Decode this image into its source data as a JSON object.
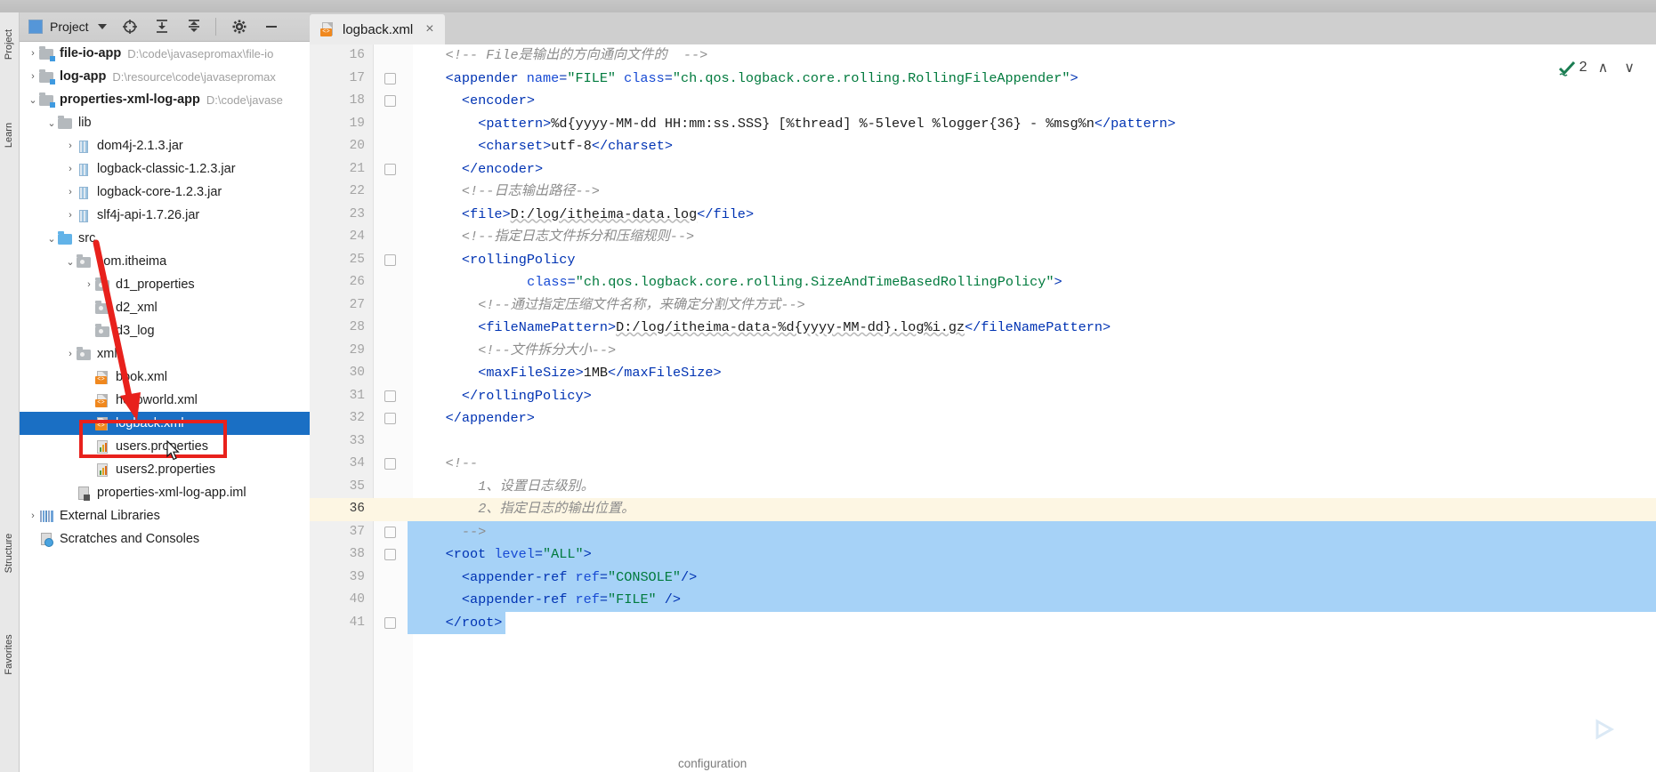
{
  "window": {
    "vertical_tabs": [
      "Project",
      "Learn",
      "Structure",
      "Favorites"
    ]
  },
  "project_panel": {
    "title": "Project",
    "toolbar_icons": [
      "target-icon",
      "expand-all-icon",
      "collapse-all-icon",
      "gear-icon",
      "minimize-icon"
    ],
    "tree": [
      {
        "id": "file-io-app",
        "label": "file-io-app",
        "path": "D:\\code\\javasepromax\\file-io",
        "indent": 0,
        "arrow": "right",
        "icon": "module-folder-icon",
        "bold": true
      },
      {
        "id": "log-app",
        "label": "log-app",
        "path": "D:\\resource\\code\\javasepromax",
        "indent": 0,
        "arrow": "right",
        "icon": "module-folder-icon",
        "bold": true
      },
      {
        "id": "properties-xml-log-app",
        "label": "properties-xml-log-app",
        "path": "D:\\code\\javase",
        "indent": 0,
        "arrow": "down",
        "icon": "module-folder-icon",
        "bold": true
      },
      {
        "id": "lib",
        "label": "lib",
        "path": "",
        "indent": 1,
        "arrow": "down",
        "icon": "folder-icon",
        "bold": false
      },
      {
        "id": "dom4j",
        "label": "dom4j-2.1.3.jar",
        "path": "",
        "indent": 2,
        "arrow": "right",
        "icon": "jar-icon",
        "bold": false
      },
      {
        "id": "logback-classic",
        "label": "logback-classic-1.2.3.jar",
        "path": "",
        "indent": 2,
        "arrow": "right",
        "icon": "jar-icon",
        "bold": false
      },
      {
        "id": "logback-core",
        "label": "logback-core-1.2.3.jar",
        "path": "",
        "indent": 2,
        "arrow": "right",
        "icon": "jar-icon",
        "bold": false
      },
      {
        "id": "slf4j-api",
        "label": "slf4j-api-1.7.26.jar",
        "path": "",
        "indent": 2,
        "arrow": "right",
        "icon": "jar-icon",
        "bold": false
      },
      {
        "id": "src",
        "label": "src",
        "path": "",
        "indent": 1,
        "arrow": "down",
        "icon": "source-folder-icon",
        "bold": false
      },
      {
        "id": "com.itheima",
        "label": "com.itheima",
        "path": "",
        "indent": 2,
        "arrow": "down",
        "icon": "package-icon",
        "bold": false
      },
      {
        "id": "d1_properties",
        "label": "d1_properties",
        "path": "",
        "indent": 3,
        "arrow": "right",
        "icon": "package-icon",
        "bold": false
      },
      {
        "id": "d2_xml",
        "label": "d2_xml",
        "path": "",
        "indent": 3,
        "arrow": "none",
        "icon": "package-icon",
        "bold": false
      },
      {
        "id": "d3_log",
        "label": "d3_log",
        "path": "",
        "indent": 3,
        "arrow": "none",
        "icon": "package-icon",
        "bold": false
      },
      {
        "id": "xml",
        "label": "xml",
        "path": "",
        "indent": 2,
        "arrow": "right",
        "icon": "package-icon",
        "bold": false
      },
      {
        "id": "book.xml",
        "label": "book.xml",
        "path": "",
        "indent": 3,
        "arrow": "none",
        "icon": "xml-file-icon",
        "bold": false
      },
      {
        "id": "helloworld.xml",
        "label": "helloworld.xml",
        "path": "",
        "indent": 3,
        "arrow": "none",
        "icon": "xml-file-icon",
        "bold": false
      },
      {
        "id": "logback.xml",
        "label": "logback.xml",
        "path": "",
        "indent": 3,
        "arrow": "none",
        "icon": "xml-file-icon",
        "bold": false,
        "selected": true
      },
      {
        "id": "users.properties",
        "label": "users.properties",
        "path": "",
        "indent": 3,
        "arrow": "none",
        "icon": "properties-file-icon",
        "bold": false
      },
      {
        "id": "users2.properties",
        "label": "users2.properties",
        "path": "",
        "indent": 3,
        "arrow": "none",
        "icon": "properties-file-icon",
        "bold": false
      },
      {
        "id": "properties-xml-log-app.iml",
        "label": "properties-xml-log-app.iml",
        "path": "",
        "indent": 2,
        "arrow": "none",
        "icon": "iml-file-icon",
        "bold": false
      },
      {
        "id": "External Libraries",
        "label": "External Libraries",
        "path": "",
        "indent": 0,
        "arrow": "right",
        "icon": "external-libraries-icon",
        "bold": false
      },
      {
        "id": "Scratches and Consoles",
        "label": "Scratches and Consoles",
        "path": "",
        "indent": 0,
        "arrow": "none",
        "icon": "scratches-icon",
        "bold": false
      }
    ]
  },
  "editor": {
    "tab": {
      "label": "logback.xml",
      "close": "×",
      "icon": "xml-file-icon"
    },
    "breadcrumb": "configuration",
    "inspection": {
      "count": "2",
      "up": "∧",
      "down": "∨",
      "icon": "inspection-ok-icon"
    },
    "first_line_number": 16,
    "lines": [
      {
        "n": 16,
        "indent": 2,
        "fold": "none",
        "segs": [
          {
            "t": "cmt",
            "s": "<!-- File是输出的方向通向文件的  -->"
          }
        ]
      },
      {
        "n": 17,
        "indent": 2,
        "fold": "open",
        "segs": [
          {
            "t": "br",
            "s": "<"
          },
          {
            "t": "tag",
            "s": "appender"
          },
          {
            "t": "txt",
            "s": " "
          },
          {
            "t": "attr",
            "s": "name"
          },
          {
            "t": "br",
            "s": "="
          },
          {
            "t": "val",
            "s": "\"FILE\""
          },
          {
            "t": "txt",
            "s": " "
          },
          {
            "t": "attr",
            "s": "class"
          },
          {
            "t": "br",
            "s": "="
          },
          {
            "t": "val",
            "s": "\"ch.qos.logback.core.rolling.RollingFileAppender\""
          },
          {
            "t": "br",
            "s": ">"
          }
        ]
      },
      {
        "n": 18,
        "indent": 3,
        "fold": "open",
        "segs": [
          {
            "t": "br",
            "s": "<"
          },
          {
            "t": "tag",
            "s": "encoder"
          },
          {
            "t": "br",
            "s": ">"
          }
        ]
      },
      {
        "n": 19,
        "indent": 4,
        "fold": "none",
        "segs": [
          {
            "t": "br",
            "s": "<"
          },
          {
            "t": "tag",
            "s": "pattern"
          },
          {
            "t": "br",
            "s": ">"
          },
          {
            "t": "txt",
            "s": "%d{yyyy-MM-dd HH:mm:ss.SSS} [%thread] %-5level %logger{36} - %msg%n"
          },
          {
            "t": "br",
            "s": "</"
          },
          {
            "t": "tag",
            "s": "pattern"
          },
          {
            "t": "br",
            "s": ">"
          }
        ]
      },
      {
        "n": 20,
        "indent": 4,
        "fold": "none",
        "segs": [
          {
            "t": "br",
            "s": "<"
          },
          {
            "t": "tag",
            "s": "charset"
          },
          {
            "t": "br",
            "s": ">"
          },
          {
            "t": "txt",
            "s": "utf-8"
          },
          {
            "t": "br",
            "s": "</"
          },
          {
            "t": "tag",
            "s": "charset"
          },
          {
            "t": "br",
            "s": ">"
          }
        ]
      },
      {
        "n": 21,
        "indent": 3,
        "fold": "close",
        "segs": [
          {
            "t": "br",
            "s": "</"
          },
          {
            "t": "tag",
            "s": "encoder"
          },
          {
            "t": "br",
            "s": ">"
          }
        ]
      },
      {
        "n": 22,
        "indent": 3,
        "fold": "none",
        "segs": [
          {
            "t": "cmt",
            "s": "<!--日志输出路径-->"
          }
        ]
      },
      {
        "n": 23,
        "indent": 3,
        "fold": "none",
        "segs": [
          {
            "t": "br",
            "s": "<"
          },
          {
            "t": "tag",
            "s": "file"
          },
          {
            "t": "br",
            "s": ">"
          },
          {
            "t": "txt",
            "s": "D:/log/itheima-data.log",
            "squig": true
          },
          {
            "t": "br",
            "s": "</"
          },
          {
            "t": "tag",
            "s": "file"
          },
          {
            "t": "br",
            "s": ">"
          }
        ]
      },
      {
        "n": 24,
        "indent": 3,
        "fold": "none",
        "segs": [
          {
            "t": "cmt",
            "s": "<!--指定日志文件拆分和压缩规则-->"
          }
        ]
      },
      {
        "n": 25,
        "indent": 3,
        "fold": "open",
        "segs": [
          {
            "t": "br",
            "s": "<"
          },
          {
            "t": "tag",
            "s": "rollingPolicy"
          }
        ]
      },
      {
        "n": 26,
        "indent": 7,
        "fold": "none",
        "segs": [
          {
            "t": "attr",
            "s": "class"
          },
          {
            "t": "br",
            "s": "="
          },
          {
            "t": "val",
            "s": "\"ch.qos.logback.core.rolling.SizeAndTimeBasedRollingPolicy\""
          },
          {
            "t": "br",
            "s": ">"
          }
        ]
      },
      {
        "n": 27,
        "indent": 4,
        "fold": "none",
        "segs": [
          {
            "t": "cmt",
            "s": "<!--通过指定压缩文件名称，来确定分割文件方式-->"
          }
        ]
      },
      {
        "n": 28,
        "indent": 4,
        "fold": "none",
        "segs": [
          {
            "t": "br",
            "s": "<"
          },
          {
            "t": "tag",
            "s": "fileNamePattern"
          },
          {
            "t": "br",
            "s": ">"
          },
          {
            "t": "txt",
            "s": "D:/log/itheima-data-%d{yyyy-MM-dd}.log%i.gz",
            "squig": true
          },
          {
            "t": "br",
            "s": "</"
          },
          {
            "t": "tag",
            "s": "fileNamePattern"
          },
          {
            "t": "br",
            "s": ">"
          }
        ]
      },
      {
        "n": 29,
        "indent": 4,
        "fold": "none",
        "segs": [
          {
            "t": "cmt",
            "s": "<!--文件拆分大小-->"
          }
        ]
      },
      {
        "n": 30,
        "indent": 4,
        "fold": "none",
        "segs": [
          {
            "t": "br",
            "s": "<"
          },
          {
            "t": "tag",
            "s": "maxFileSize"
          },
          {
            "t": "br",
            "s": ">"
          },
          {
            "t": "txt",
            "s": "1MB"
          },
          {
            "t": "br",
            "s": "</"
          },
          {
            "t": "tag",
            "s": "maxFileSize"
          },
          {
            "t": "br",
            "s": ">"
          }
        ]
      },
      {
        "n": 31,
        "indent": 3,
        "fold": "close",
        "segs": [
          {
            "t": "br",
            "s": "</"
          },
          {
            "t": "tag",
            "s": "rollingPolicy"
          },
          {
            "t": "br",
            "s": ">"
          }
        ]
      },
      {
        "n": 32,
        "indent": 2,
        "fold": "close",
        "segs": [
          {
            "t": "br",
            "s": "</"
          },
          {
            "t": "tag",
            "s": "appender"
          },
          {
            "t": "br",
            "s": ">"
          }
        ]
      },
      {
        "n": 33,
        "indent": 0,
        "fold": "none",
        "segs": []
      },
      {
        "n": 34,
        "indent": 2,
        "fold": "open",
        "segs": [
          {
            "t": "cmt",
            "s": "<!--"
          }
        ]
      },
      {
        "n": 35,
        "indent": 4,
        "fold": "none",
        "segs": [
          {
            "t": "cmt",
            "s": "1、设置日志级别。"
          }
        ]
      },
      {
        "n": 36,
        "indent": 4,
        "fold": "none",
        "segs": [
          {
            "t": "cmt",
            "s": "2、指定日志的输出位置。"
          }
        ]
      },
      {
        "n": 37,
        "indent": 3,
        "fold": "close",
        "segs": [
          {
            "t": "cmt",
            "s": "-->"
          }
        ]
      },
      {
        "n": 38,
        "indent": 2,
        "fold": "open",
        "segs": [
          {
            "t": "br",
            "s": "<"
          },
          {
            "t": "tag",
            "s": "root"
          },
          {
            "t": "txt",
            "s": " "
          },
          {
            "t": "attr",
            "s": "level"
          },
          {
            "t": "br",
            "s": "="
          },
          {
            "t": "val",
            "s": "\"ALL\""
          },
          {
            "t": "br",
            "s": ">"
          }
        ]
      },
      {
        "n": 39,
        "indent": 3,
        "fold": "none",
        "segs": [
          {
            "t": "br",
            "s": "<"
          },
          {
            "t": "tag",
            "s": "appender-ref"
          },
          {
            "t": "txt",
            "s": " "
          },
          {
            "t": "attr",
            "s": "ref"
          },
          {
            "t": "br",
            "s": "="
          },
          {
            "t": "val",
            "s": "\"CONSOLE\""
          },
          {
            "t": "br",
            "s": "/>"
          }
        ]
      },
      {
        "n": 40,
        "indent": 3,
        "fold": "none",
        "segs": [
          {
            "t": "br",
            "s": "<"
          },
          {
            "t": "tag",
            "s": "appender-ref"
          },
          {
            "t": "txt",
            "s": " "
          },
          {
            "t": "attr",
            "s": "ref"
          },
          {
            "t": "br",
            "s": "="
          },
          {
            "t": "val",
            "s": "\"FILE\""
          },
          {
            "t": "txt",
            "s": " "
          },
          {
            "t": "br",
            "s": "/>"
          }
        ]
      },
      {
        "n": 41,
        "indent": 2,
        "fold": "close",
        "segs": [
          {
            "t": "br",
            "s": "</"
          },
          {
            "t": "tag",
            "s": "root"
          },
          {
            "t": "br",
            "s": ">"
          }
        ]
      }
    ],
    "caret_line": 36,
    "selection": {
      "from_line": 36,
      "to_line": 41
    }
  },
  "annotations": {
    "highlight_box_target": "logback.xml",
    "arrow_from": "src",
    "arrow_to": "logback.xml",
    "color": "#e8211c"
  },
  "watermark": {
    "icon": "tv-play-icon"
  }
}
